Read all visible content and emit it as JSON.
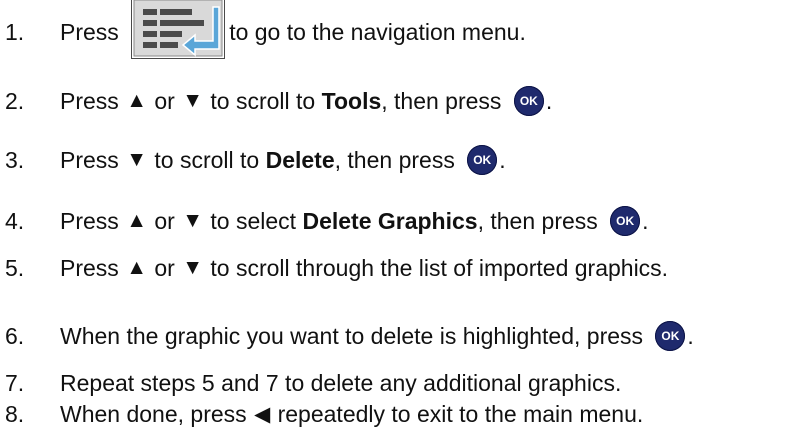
{
  "steps": [
    {
      "number": "1.",
      "segments": [
        {
          "t": "text",
          "v": "Press "
        },
        {
          "t": "navicon",
          "name": "navigation-menu-icon"
        },
        {
          "t": "text",
          "v": "to go to the navigation menu."
        }
      ]
    },
    {
      "number": "2.",
      "segments": [
        {
          "t": "text",
          "v": "Press "
        },
        {
          "t": "sym",
          "v": "▲"
        },
        {
          "t": "text",
          "v": " or "
        },
        {
          "t": "sym",
          "v": "▼"
        },
        {
          "t": "text",
          "v": " to scroll to "
        },
        {
          "t": "bold",
          "v": "Tools"
        },
        {
          "t": "text",
          "v": ", then press "
        },
        {
          "t": "ok",
          "v": "OK",
          "name": "ok-button-icon"
        },
        {
          "t": "text",
          "v": "."
        }
      ]
    },
    {
      "number": "3.",
      "segments": [
        {
          "t": "text",
          "v": "Press "
        },
        {
          "t": "sym",
          "v": "▼"
        },
        {
          "t": "text",
          "v": " to scroll to "
        },
        {
          "t": "bold",
          "v": "Delete"
        },
        {
          "t": "text",
          "v": ", then press "
        },
        {
          "t": "ok",
          "v": "OK",
          "name": "ok-button-icon"
        },
        {
          "t": "text",
          "v": "."
        }
      ]
    },
    {
      "number": "4.",
      "segments": [
        {
          "t": "text",
          "v": "Press "
        },
        {
          "t": "sym",
          "v": "▲"
        },
        {
          "t": "text",
          "v": " or "
        },
        {
          "t": "sym",
          "v": "▼"
        },
        {
          "t": "text",
          "v": " to select "
        },
        {
          "t": "bold",
          "v": "Delete Graphics"
        },
        {
          "t": "text",
          "v": ", then press "
        },
        {
          "t": "ok",
          "v": "OK",
          "name": "ok-button-icon"
        },
        {
          "t": "text",
          "v": "."
        }
      ]
    },
    {
      "number": "5.",
      "segments": [
        {
          "t": "text",
          "v": "Press "
        },
        {
          "t": "sym",
          "v": "▲"
        },
        {
          "t": "text",
          "v": " or "
        },
        {
          "t": "sym",
          "v": "▼"
        },
        {
          "t": "text",
          "v": " to scroll through the list of imported graphics."
        }
      ]
    },
    {
      "number": "6.",
      "segments": [
        {
          "t": "text",
          "v": "When the graphic you want to delete is highlighted, press "
        },
        {
          "t": "ok",
          "v": "OK",
          "name": "ok-button-icon"
        },
        {
          "t": "text",
          "v": "."
        }
      ]
    },
    {
      "number": "7.",
      "segments": [
        {
          "t": "text",
          "v": "Repeat steps 5 and 7 to delete any additional graphics."
        }
      ]
    },
    {
      "number": "8.",
      "segments": [
        {
          "t": "text",
          "v": "When done, press "
        },
        {
          "t": "sym",
          "v": "◀"
        },
        {
          "t": "text",
          "v": " repeatedly to exit to the main menu."
        }
      ]
    }
  ],
  "colors": {
    "ok_button": "#1f2a6d",
    "nav_icon_border": "#4a4a4a",
    "nav_icon_face": "#d9d9d9",
    "nav_icon_arrow": "#5aa6d8"
  }
}
